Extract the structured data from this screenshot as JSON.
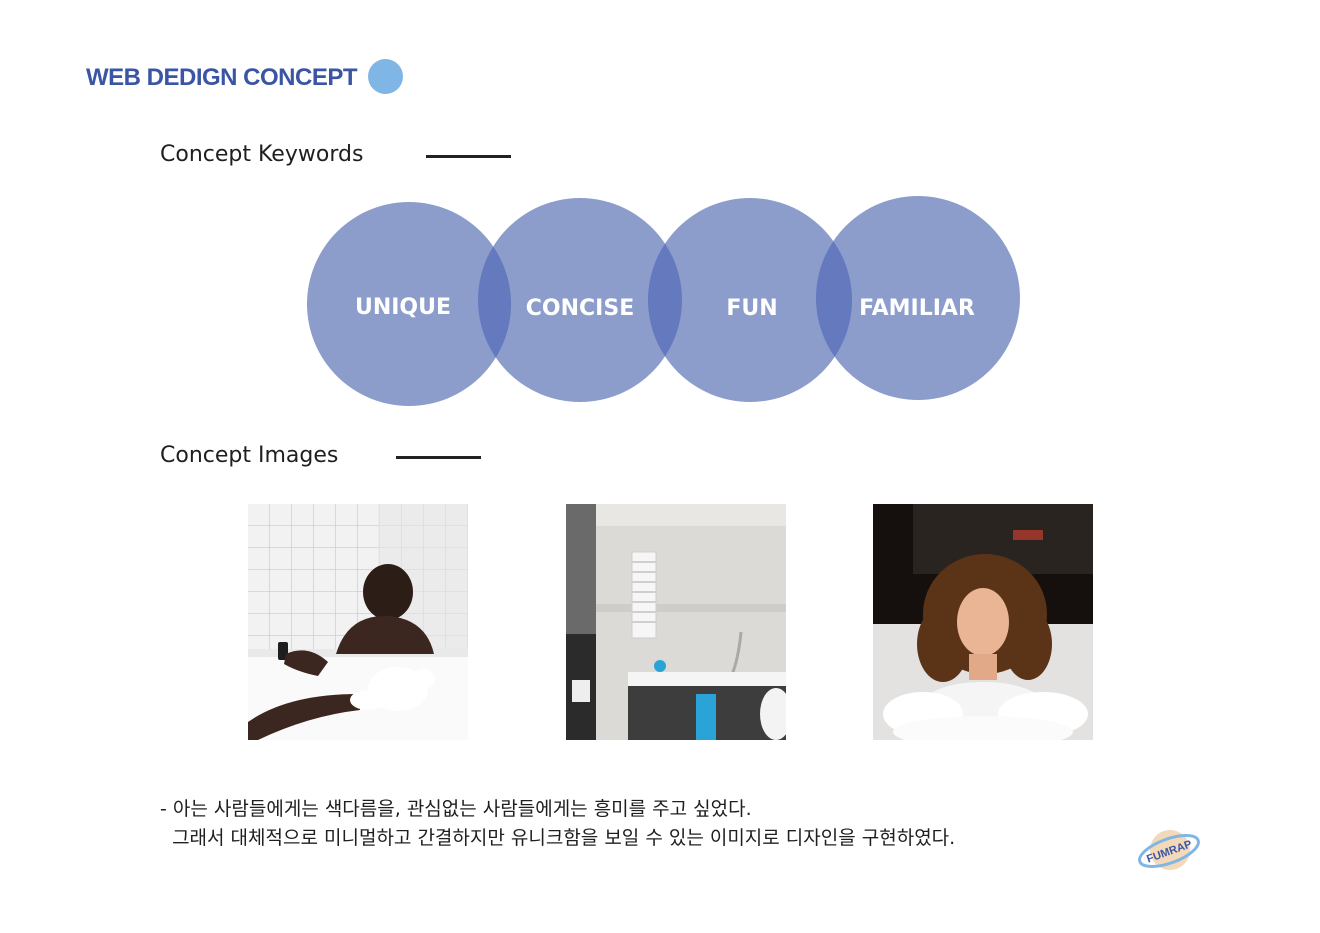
{
  "header": {
    "title": "WEB DEDIGN CONCEPT"
  },
  "sections": {
    "keywords_label": "Concept Keywords",
    "images_label": "Concept Images"
  },
  "keywords": [
    "UNIQUE",
    "CONCISE",
    "FUN",
    "FAMILIAR"
  ],
  "colors": {
    "accent": "#3a55a4",
    "circle": "#8c9dcc",
    "overlap": "#6479be",
    "dot": "#7fb6e6"
  },
  "description": {
    "line1": "- 아는 사람들에게는 색다름을, 관심없는 사람들에게는 흥미를 주고 싶었다.",
    "line2": "  그래서 대체적으로 미니멀하고 간결하지만 유니크함을 보일 수 있는 이미지로 디자인을 구현하였다."
  },
  "logo": {
    "text": "FUMRAP"
  }
}
